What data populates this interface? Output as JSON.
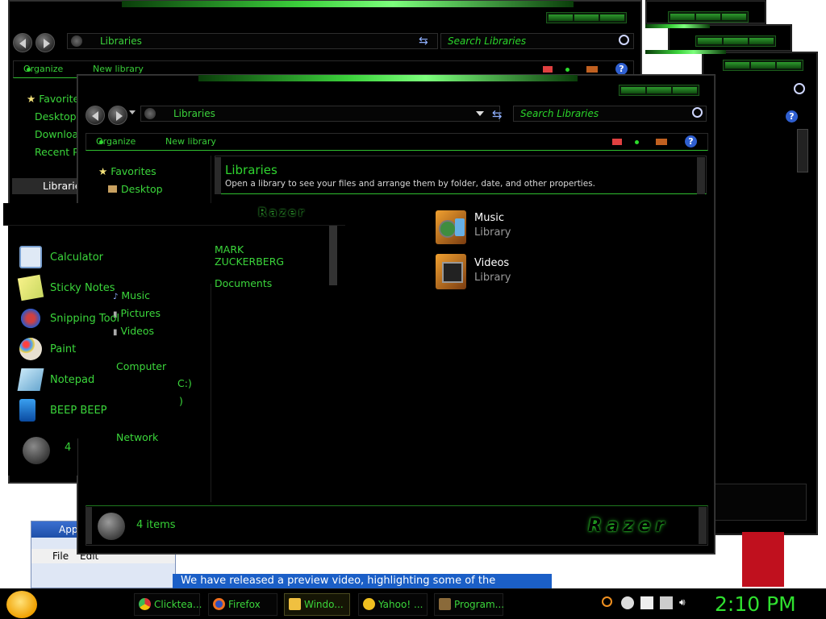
{
  "back_window": {
    "address": "Libraries",
    "search_placeholder": "Search Libraries",
    "toolbar": {
      "organize": "Organize",
      "new_library": "New library"
    },
    "nav": [
      {
        "label": "Favorites"
      },
      {
        "label": "Desktop"
      },
      {
        "label": "Downloads"
      },
      {
        "label": "Recent Places"
      }
    ],
    "libraries_label": "Libraries"
  },
  "front_window": {
    "address": "Libraries",
    "search_placeholder": "Search Libraries",
    "toolbar": {
      "organize": "Organize",
      "new_library": "New library"
    },
    "nav": {
      "favorites": "Favorites",
      "desktop": "Desktop",
      "music": "Music",
      "pictures": "Pictures",
      "videos": "Videos",
      "computer": "Computer",
      "network": "Network"
    },
    "header": {
      "title": "Libraries",
      "subtitle": "Open a library to see your files and arrange them by folder, date, and other properties."
    },
    "items": [
      {
        "name": "Music",
        "type": "Library"
      },
      {
        "name": "Videos",
        "type": "Library"
      }
    ],
    "status": "4 items",
    "brand": "Razer"
  },
  "start_menu": {
    "programs": [
      {
        "label": "Calculator",
        "icon": "calculator-icon"
      },
      {
        "label": "Sticky Notes",
        "icon": "sticky-notes-icon"
      },
      {
        "label": "Snipping Tool",
        "icon": "snipping-tool-icon"
      },
      {
        "label": "Paint",
        "icon": "paint-icon"
      },
      {
        "label": "Notepad",
        "icon": "notepad-icon"
      },
      {
        "label": "BEEP BEEP",
        "icon": "beep-icon"
      }
    ],
    "user": "MARK ZUCKERBERG",
    "right_items": [
      "Documents"
    ],
    "items_count": "4",
    "brand": "Razer",
    "drive_labels": [
      "C:)",
      ")"
    ]
  },
  "background": {
    "app_label": "App",
    "menu_file": "File",
    "menu_edit": "Edit",
    "web_text": "We have released a preview video, highlighting some of the"
  },
  "taskbar": {
    "tasks": [
      {
        "label": "Clicktea...",
        "icon": "chrome-icon"
      },
      {
        "label": "Firefox",
        "icon": "firefox-icon"
      },
      {
        "label": "Windo...",
        "icon": "folder-icon"
      },
      {
        "label": "Yahoo! ...",
        "icon": "yahoo-icon"
      },
      {
        "label": "Program...",
        "icon": "program-icon"
      }
    ],
    "clock": "2:10 PM"
  },
  "colors": {
    "accent": "#36d136",
    "bg": "#000000"
  }
}
